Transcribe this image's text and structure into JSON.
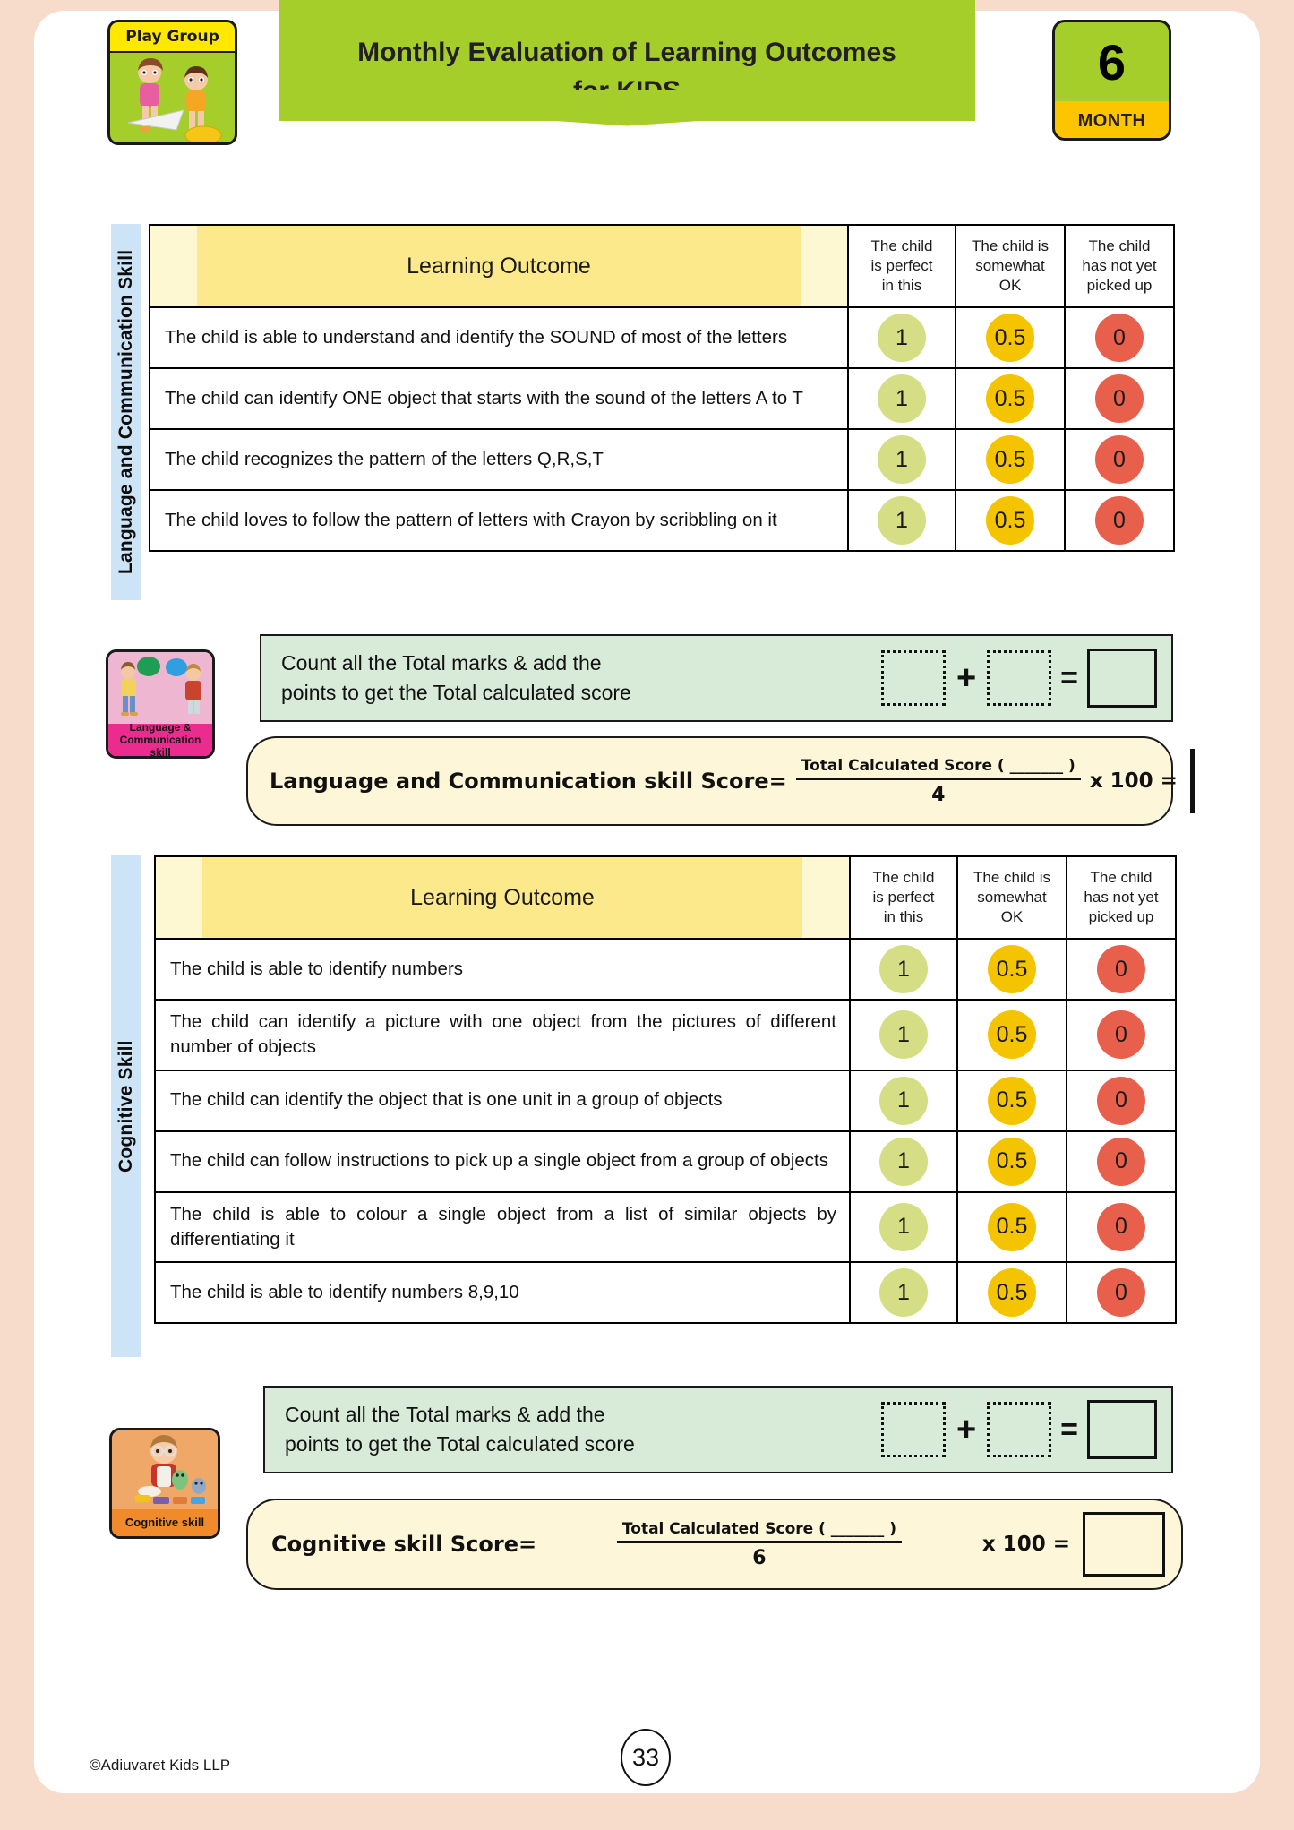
{
  "header": {
    "playgroup_label": "Play Group",
    "title_line1": "Monthly Evaluation of Learning Outcomes",
    "title_line2": "for KIDS",
    "month_number": "6",
    "month_label": "MONTH",
    "colors": {
      "banner_green": "#a6ce2b",
      "banner_yellow": "#f5e400",
      "month_bottom": "#fdc400",
      "page_border": "#f8dccb"
    }
  },
  "columns": {
    "outcome": "Learning Outcome",
    "perfect": "The child\nis perfect\nin this",
    "somewhat": "The child is\nsomewhat\nOK",
    "not_yet": "The child\nhas not yet\npicked up"
  },
  "scores": {
    "one": "1",
    "half": "0.5",
    "zero": "0",
    "color_one": "#d5de84",
    "color_half": "#f5c400",
    "color_zero": "#e8604c"
  },
  "sections": [
    {
      "side_label": "Language and Communication Skill",
      "badge_caption": "Language &\nCommunication\nskill",
      "badge_bg": "#efb6d2",
      "badge_cap_bg": "#ec2b8f",
      "rows": [
        "The child is able to understand and identify the SOUND of most of the letters",
        "The child can identify ONE object that starts with the sound of the letters A to T",
        "The child recognizes the pattern of the letters Q,R,S,T",
        "The child loves to follow the pattern of letters with Crayon by scribbling on it"
      ],
      "total_text_line1": "Count all the Total marks & add the",
      "total_text_line2": "points to get the Total calculated score",
      "formula_label": "Language and Communication skill Score=",
      "formula_numerator": "Total Calculated Score ( _______ )",
      "formula_denominator": "4",
      "formula_multiplier": "x 100 ="
    },
    {
      "side_label": "Cognitive Skill",
      "badge_caption": "Cognitive skill",
      "badge_bg": "#f0a868",
      "badge_cap_bg": "#f08a2b",
      "rows": [
        "The child is able to identify numbers",
        "The child can identify a picture with one object from the pictures of different number of objects",
        "The child can identify the object that is one unit in a group of objects",
        "The child can follow instructions to pick up a single object from a group of objects",
        "The child is able to colour a single object from a list of similar objects by differentiating it",
        "The child is able to identify numbers  8,9,10"
      ],
      "total_text_line1": "Count all the Total marks & add the",
      "total_text_line2": "points to get the Total calculated score",
      "formula_label": "Cognitive skill Score=",
      "formula_numerator": "Total Calculated Score ( _______ )",
      "formula_denominator": "6",
      "formula_multiplier": "x 100 ="
    }
  ],
  "footer": {
    "copyright": "©Adiuvaret Kids LLP",
    "page_number": "33"
  }
}
